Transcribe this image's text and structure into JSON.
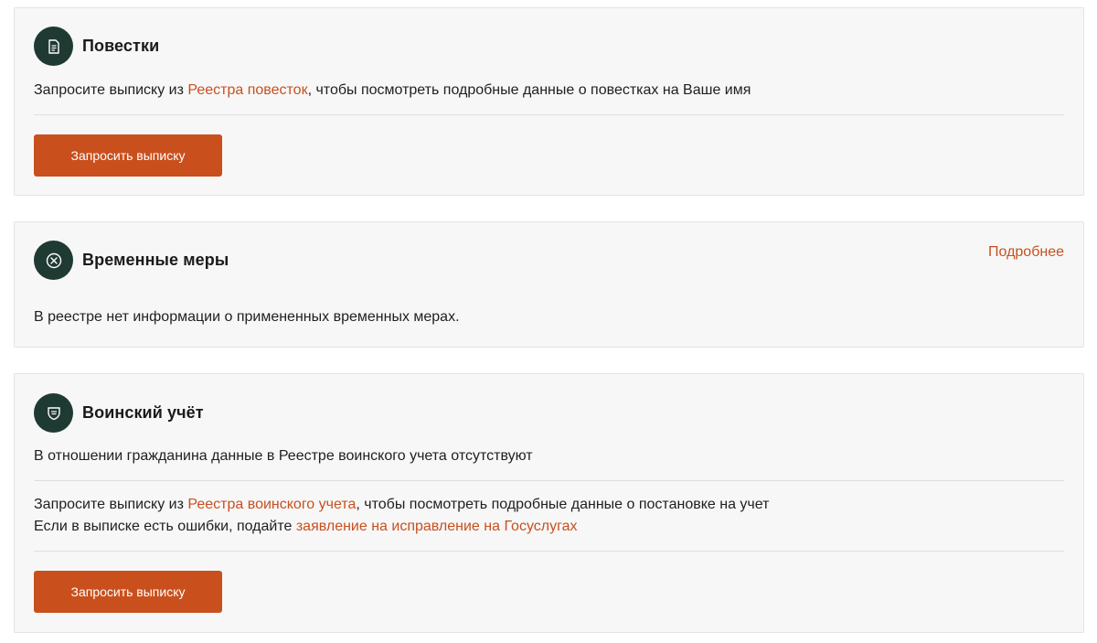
{
  "subpoenas": {
    "title": "Повестки",
    "icon": "document-icon",
    "text_before": "Запросите выписку из ",
    "link": "Реестра повесток",
    "text_after": ", чтобы посмотреть подробные данные о повестках на Ваше имя",
    "button": "Запросить выписку"
  },
  "temporary_measures": {
    "title": "Временные меры",
    "icon": "close-circle-icon",
    "more_link": "Подробнее",
    "text": "В реестре нет информации о примененных временных мерах."
  },
  "military_registration": {
    "title": "Воинский учёт",
    "icon": "shield-icon",
    "status_text": "В отношении гражданина данные в Реестре воинского учета отсутствуют",
    "request_before": "Запросите выписку из ",
    "request_link": "Реестра воинского учета",
    "request_after": ",  чтобы посмотреть подробные данные о постановке на учет",
    "errors_before": "Если в выписке есть ошибки, подайте ",
    "errors_link": "заявление на исправление на Госуслугах",
    "button": "Запросить выписку"
  },
  "colors": {
    "accent": "#c9501d",
    "icon_bg": "#1f3a32",
    "card_bg": "#f7f7f7"
  }
}
